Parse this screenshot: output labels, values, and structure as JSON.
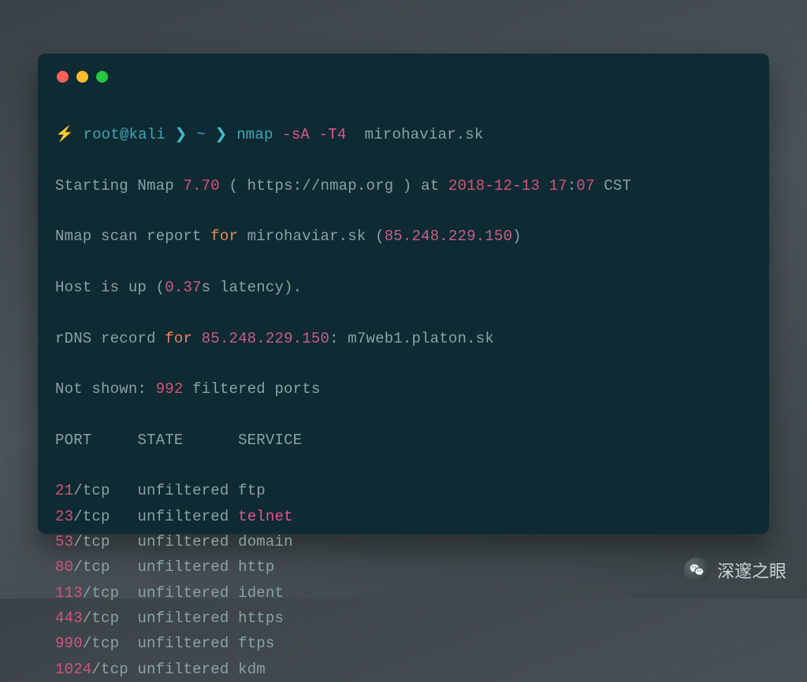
{
  "prompt": {
    "lightning": "⚡",
    "user_host": "root@kali",
    "chev1": "❯",
    "cwd": "~",
    "chev2": "❯",
    "cmd_bin": "nmap",
    "cmd_flags": "-sA -T4",
    "cmd_target": "mirohaviar.sk"
  },
  "lines": {
    "l1_a": "Starting Nmap ",
    "l1_ver": "7.70",
    "l1_b": " ( https://nmap.org ) at ",
    "l1_date_y": "2018",
    "l1_date_sep1": "-",
    "l1_date_m": "12",
    "l1_date_sep2": "-",
    "l1_date_d": "13",
    "l1_sp": " ",
    "l1_time_h": "17",
    "l1_time_sep": ":",
    "l1_time_m": "07",
    "l1_tz": " CST",
    "l2_a": "Nmap scan report ",
    "l2_for": "for",
    "l2_b": " mirohaviar.sk (",
    "l2_ip": "85.248.229.150",
    "l2_c": ")",
    "l3_a": "Host is up (",
    "l3_num": "0.37",
    "l3_b": "s latency).",
    "l4_a": "rDNS record ",
    "l4_for": "for",
    "l4_sp": " ",
    "l4_ip": "85.248.229.150",
    "l4_b": ": m7web1.platon.sk",
    "l5_a": "Not shown: ",
    "l5_num": "992",
    "l5_b": " filtered ports",
    "hdr_port": "PORT",
    "hdr_state": "STATE",
    "hdr_service": "SERVICE"
  },
  "ports": [
    {
      "num": "21",
      "proto": "/tcp",
      "pad": "   ",
      "state": "unfiltered",
      "svc": "ftp",
      "svc_pink": false
    },
    {
      "num": "23",
      "proto": "/tcp",
      "pad": "   ",
      "state": "unfiltered",
      "svc": "telnet",
      "svc_pink": true
    },
    {
      "num": "53",
      "proto": "/tcp",
      "pad": "   ",
      "state": "unfiltered",
      "svc": "domain",
      "svc_pink": false
    },
    {
      "num": "80",
      "proto": "/tcp",
      "pad": "   ",
      "state": "unfiltered",
      "svc": "http",
      "svc_pink": false
    },
    {
      "num": "113",
      "proto": "/tcp",
      "pad": "  ",
      "state": "unfiltered",
      "svc": "ident",
      "svc_pink": false
    },
    {
      "num": "443",
      "proto": "/tcp",
      "pad": "  ",
      "state": "unfiltered",
      "svc": "https",
      "svc_pink": false
    },
    {
      "num": "990",
      "proto": "/tcp",
      "pad": "  ",
      "state": "unfiltered",
      "svc": "ftps",
      "svc_pink": false
    },
    {
      "num": "1024",
      "proto": "/tcp",
      "pad": " ",
      "state": "unfiltered",
      "svc": "kdm",
      "svc_pink": false
    }
  ],
  "watermark": {
    "text": "深邃之眼"
  }
}
